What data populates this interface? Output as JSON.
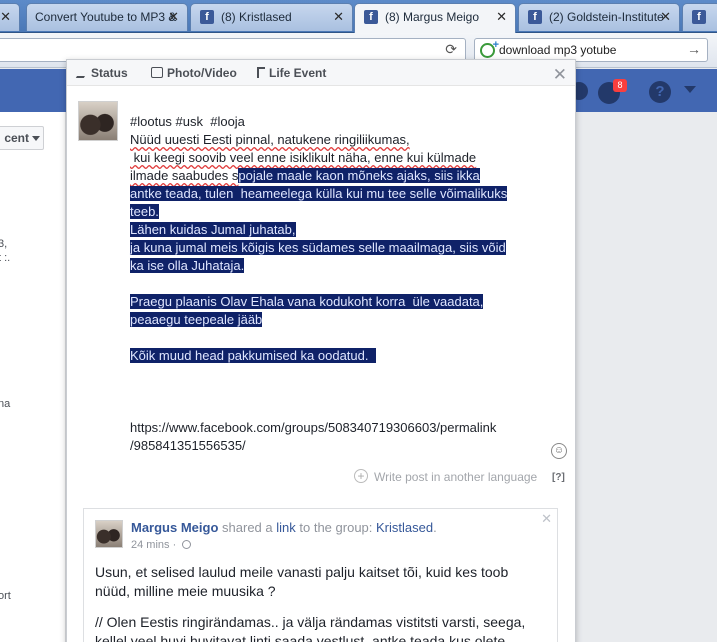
{
  "browser": {
    "tabs": [
      {
        "label": "",
        "active": false
      },
      {
        "label": "Convert Youtube to MP3 &",
        "active": false
      },
      {
        "label": "(8) Kristlased",
        "active": false
      },
      {
        "label": "(8) Margus Meigo",
        "active": true
      },
      {
        "label": "(2) Goldstein-Institute",
        "active": false
      },
      {
        "label": "",
        "active": false
      }
    ],
    "search": {
      "query": "download mp3 yotube"
    }
  },
  "fb": {
    "notification_count": "8",
    "help_glyph": "?",
    "left_column": {
      "sort_button_label": "cent",
      "fragments": [
        "3,",
        "t :.",
        "na",
        "ort"
      ]
    }
  },
  "composer": {
    "tabs": [
      "Status",
      "Photo/Video",
      "Life Event"
    ],
    "close_glyph": "✕",
    "text_lines": [
      {
        "plain": "#lootus #usk  #looja",
        "selected": ""
      },
      {
        "plain": "Nüüd uuesti Eesti pinnal, natukene ringiliikumas,",
        "selected": ""
      },
      {
        "plain": " kui keegi soovib veel enne isiklikult näha, enne kui külmade",
        "selected": ""
      },
      {
        "plain": "ilmade saabudes s",
        "selected": "pojale maale kaon mõneks ajaks, siis ikka"
      },
      {
        "plain": "",
        "selected": "antke teada, tulen  heameelega külla kui mu tee selle võimalikuks"
      },
      {
        "plain": "",
        "selected": "teeb."
      },
      {
        "plain": "",
        "selected": "Lähen kuidas Jumal juhatab,"
      },
      {
        "plain": "",
        "selected": "ja kuna jumal meis kõigis kes südames selle maailmaga, siis võid"
      },
      {
        "plain": "",
        "selected": "ka ise olla Juhataja."
      },
      {
        "plain": "",
        "selected": ""
      },
      {
        "plain": "",
        "selected": "Praegu plaanis Olav Ehala vana kodukoht korra  üle vaadata,"
      },
      {
        "plain": "",
        "selected": "peaaegu teepeale jääb"
      },
      {
        "plain": "",
        "selected": ""
      },
      {
        "plain": "",
        "selected": "Kõik muud head pakkumised ka oodatud.  "
      }
    ],
    "url_text": "https://www.facebook.com/groups/508340719306603/permalink\n/985841351556535/",
    "translate_label": "Write post in another language",
    "translate_help": "[?]"
  },
  "shared_post": {
    "author": "Margus Meigo",
    "verb_text": "shared a",
    "link_text": "link",
    "to_group_text": "to the group:",
    "group": "Kristlased",
    "time": "24 mins",
    "paragraphs": [
      "Usun, et selised laulud meile vanasti palju kaitset tõi, kuid kes toob nüüd, milline meie muusika ?",
      "// Olen Eestis ringirändamas.. ja välja rändamas vistitsti varsti, seega, kellel veel huvi huvitavat linti saada vestlust, antke teada kus olete"
    ]
  }
}
